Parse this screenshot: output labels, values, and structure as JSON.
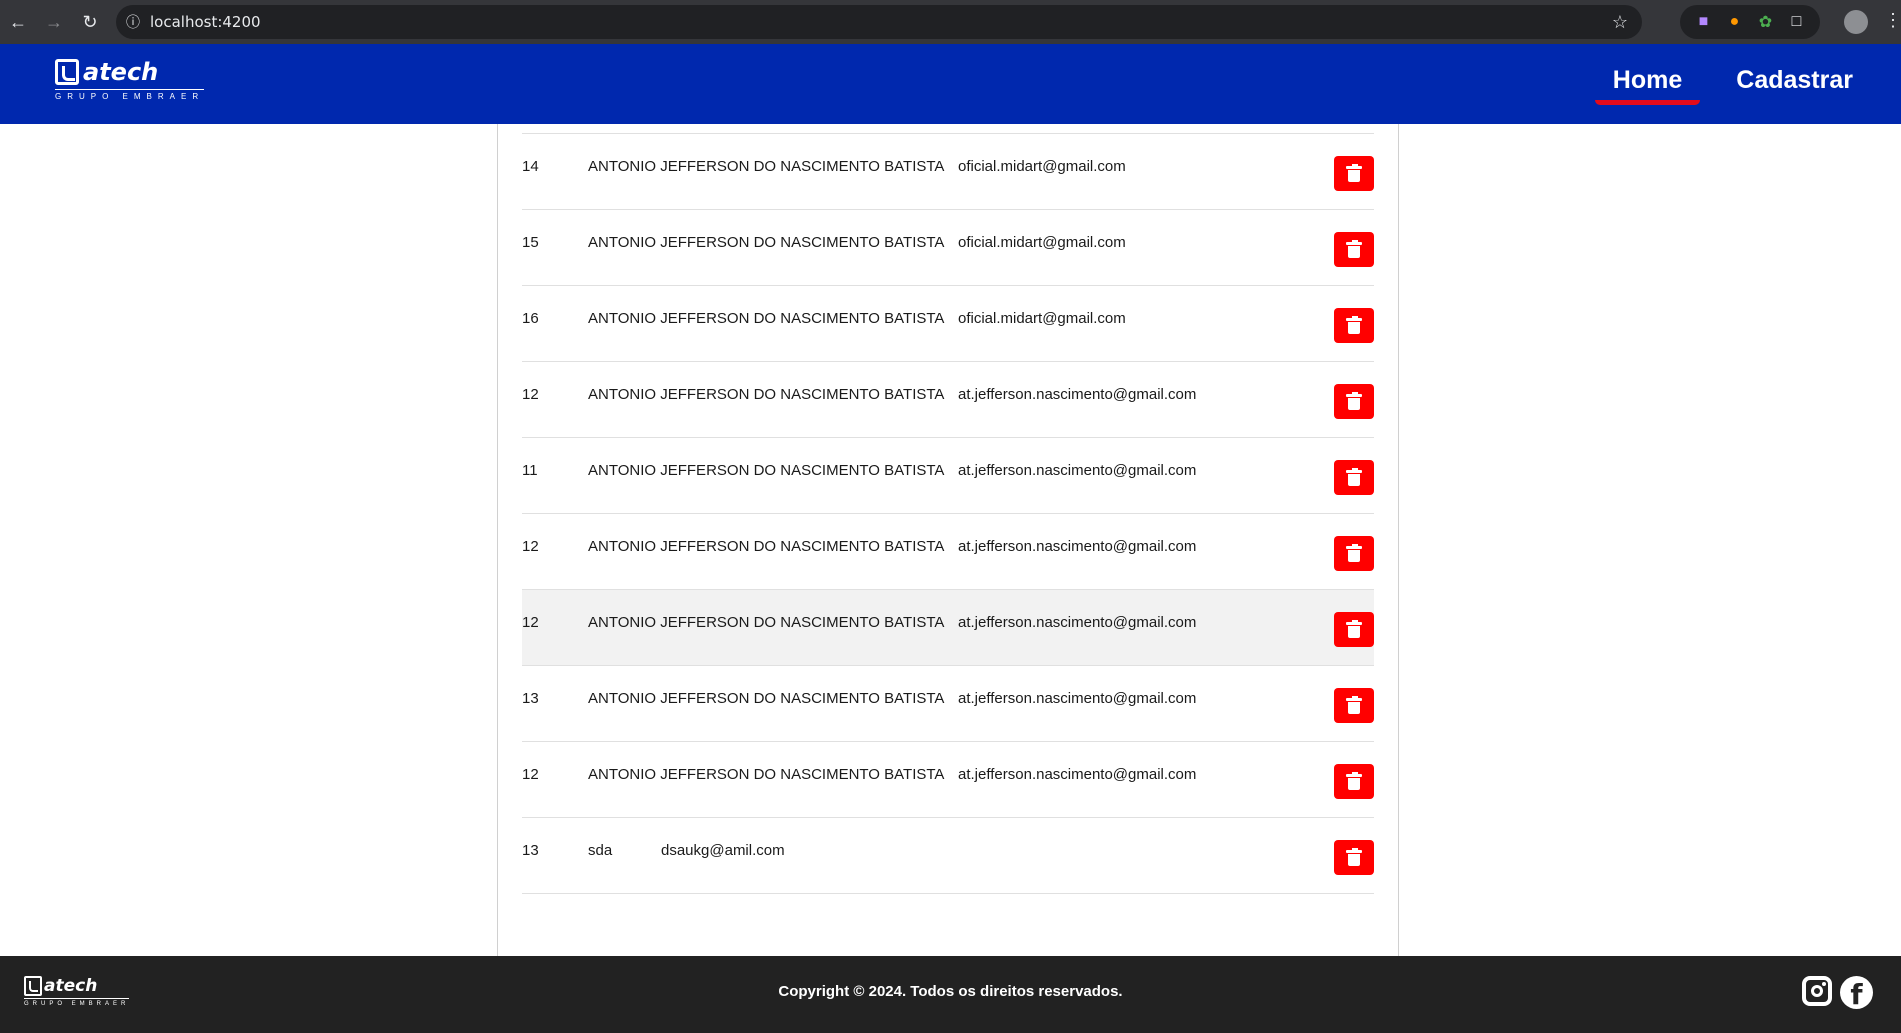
{
  "browser": {
    "url": "localhost:4200"
  },
  "header": {
    "logo_text": "atech",
    "logo_sub": "GRUPO EMBRAER",
    "nav": {
      "home": "Home",
      "register": "Cadastrar"
    },
    "colors": {
      "background": "#0028ae",
      "active_underline": "#e30b1b"
    }
  },
  "users": [
    {
      "id": "14",
      "name": "ANTONIO JEFFERSON DO NASCIMENTO BATISTA",
      "email": "oficial.midart@gmail.com"
    },
    {
      "id": "15",
      "name": "ANTONIO JEFFERSON DO NASCIMENTO BATISTA",
      "email": "oficial.midart@gmail.com"
    },
    {
      "id": "16",
      "name": "ANTONIO JEFFERSON DO NASCIMENTO BATISTA",
      "email": "oficial.midart@gmail.com"
    },
    {
      "id": "12",
      "name": "ANTONIO JEFFERSON DO NASCIMENTO BATISTA",
      "email": "at.jefferson.nascimento@gmail.com"
    },
    {
      "id": "11",
      "name": "ANTONIO JEFFERSON DO NASCIMENTO BATISTA",
      "email": "at.jefferson.nascimento@gmail.com"
    },
    {
      "id": "12",
      "name": "ANTONIO JEFFERSON DO NASCIMENTO BATISTA",
      "email": "at.jefferson.nascimento@gmail.com"
    },
    {
      "id": "12",
      "name": "ANTONIO JEFFERSON DO NASCIMENTO BATISTA",
      "email": "at.jefferson.nascimento@gmail.com"
    },
    {
      "id": "13",
      "name": "ANTONIO JEFFERSON DO NASCIMENTO BATISTA",
      "email": "at.jefferson.nascimento@gmail.com"
    },
    {
      "id": "12",
      "name": "ANTONIO JEFFERSON DO NASCIMENTO BATISTA",
      "email": "at.jefferson.nascimento@gmail.com"
    },
    {
      "id": "13",
      "name": "sda",
      "email": "dsaukg@amil.com"
    }
  ],
  "delete_icon": "trash-icon",
  "delete_color": "#ff0000",
  "footer": {
    "logo_text": "atech",
    "logo_sub": "GRUPO EMBRAER",
    "copyright": "Copyright © 2024. Todos os direitos reservados.",
    "social": [
      "instagram-icon",
      "facebook-icon"
    ],
    "facebook_glyph": "f"
  }
}
